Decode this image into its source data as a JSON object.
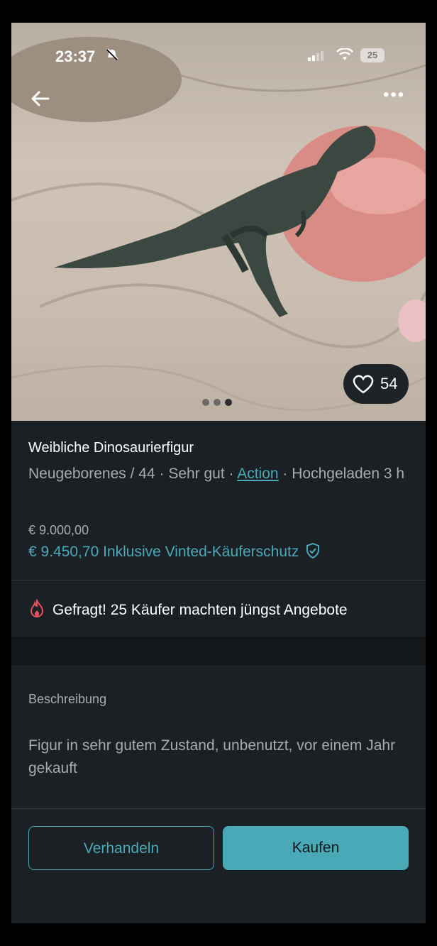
{
  "status_bar": {
    "time": "23:37",
    "battery": "25"
  },
  "photo": {
    "likes": "54",
    "image_count": 3,
    "active_image_index": 3
  },
  "item": {
    "title": "Weibliche Dinosaurierfigur",
    "size": "Neugeborenes / 44",
    "condition": "Sehr gut",
    "brand": "Action",
    "uploaded": "Hochgeladen 3 h",
    "price": "€ 9.000,00",
    "price_total": "€ 9.450,70 Inklusive Vinted-Käuferschutz"
  },
  "demand_text": "Gefragt! 25 Käufer machten jüngst Angebote",
  "description": {
    "label": "Beschreibung",
    "text": "Figur in sehr gutem Zustand, unbenutzt, vor einem Jahr gekauft"
  },
  "actions": {
    "negotiate": "Verhandeln",
    "buy": "Kaufen"
  },
  "colors": {
    "accent": "#4aa9b7",
    "background": "#1b2025",
    "demand_icon": "#e8525e"
  },
  "icons": [
    "back-arrow-icon",
    "more-icon",
    "heart-icon",
    "shield-check-icon",
    "flame-icon",
    "bell-slash-icon",
    "wifi-icon",
    "signal-icon"
  ]
}
